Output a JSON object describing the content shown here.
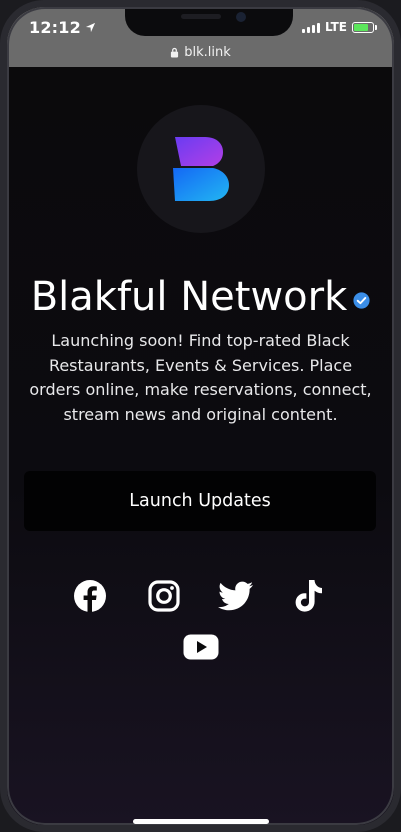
{
  "status_bar": {
    "time": "12:12",
    "network": "LTE"
  },
  "browser": {
    "url": "blk.link"
  },
  "profile": {
    "name": "Blakful Network",
    "description": "Launching soon! Find top-rated Black Restaurants, Events & Services. Place orders online, make reservations, connect, stream news and original content.",
    "logo_letter": "B"
  },
  "links": [
    {
      "label": "Launch Updates"
    }
  ],
  "social_icons": [
    "facebook-icon",
    "instagram-icon",
    "twitter-icon",
    "tiktok-icon",
    "youtube-icon"
  ],
  "colors": {
    "background": "#0b0a0c",
    "status_bar": "#6b6b6b",
    "button_bg": "#020203",
    "verified": "#3b8ee8",
    "logo_top": "#8b3cf0",
    "logo_bottom": "#1e9bf0",
    "battery": "#5ce65c"
  }
}
